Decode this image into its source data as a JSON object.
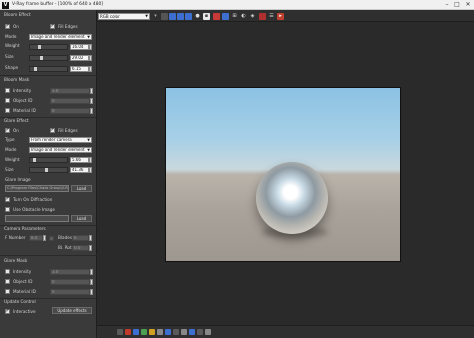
{
  "window": {
    "title": "V-Ray frame buffer - [100% of 640 x 480]",
    "app_icon": "V"
  },
  "bloom_effect": {
    "section": "Bloom Effect",
    "on_label": "On",
    "fill_edges_label": "Fill Edges",
    "mode_label": "Mode",
    "mode_value": "Image and render element",
    "weight_label": "Weight",
    "weight_value": "16.04",
    "size_label": "Size",
    "size_value": "29.02",
    "shape_label": "Shape",
    "shape_value": "6.15"
  },
  "bloom_mask": {
    "section": "Bloom Mask",
    "intensity_label": "Intensity",
    "intensity_value": "3.0",
    "object_id_label": "Object ID",
    "object_id_value": "0",
    "material_id_label": "Material ID",
    "material_id_value": "0"
  },
  "glare_effect": {
    "section": "Glare Effect",
    "on_label": "On",
    "fill_edges_label": "Fill Edges",
    "type_label": "Type",
    "type_value": "From render camera",
    "mode_label": "Mode",
    "mode_value": "Image and render element",
    "weight_label": "Weight",
    "weight_value": "5.66",
    "size_label": "Size",
    "size_value": "41.36",
    "glare_image_label": "Glare Image",
    "glare_image_path": "C:\\Program Files\\Chaos Group\\V-Ray",
    "load_label": "Load",
    "diffraction_label": "Turn On Diffraction",
    "obstacle_label": "Use Obstacle Image",
    "obstacle_load_label": "Load"
  },
  "camera_parameters": {
    "section": "Camera Parameters",
    "fnumber_label": "F Number",
    "fnumber_value": "8.0",
    "blades_label": "Blades",
    "blades_value": "6",
    "rotation_label": "Bl. Rot",
    "rotation_value": "0.0"
  },
  "glare_mask": {
    "section": "Glare Mask",
    "intensity_label": "Intensity",
    "intensity_value": "3.0",
    "object_id_label": "Object ID",
    "object_id_value": "0",
    "material_id_label": "Material ID",
    "material_id_value": "0"
  },
  "update_control": {
    "section": "Update Control",
    "interactive_label": "Interactive",
    "update_button": "Update effects"
  },
  "toolbar": {
    "channel_value": "RGB color",
    "icons": [
      "save-icon",
      "clear-icon",
      "red-channel-icon",
      "green-channel-icon",
      "blue-channel-icon",
      "mono-icon",
      "alpha-icon",
      "color-icon",
      "region-icon",
      "compare-icon",
      "track-icon",
      "lock-icon",
      "stop-icon",
      "history-icon",
      "render-icon"
    ]
  },
  "colors": {
    "panel": "#3a3a3a",
    "viewport": "#2a2a2a",
    "channel_blue": "#3c6fd0",
    "accent_red": "#c83a3a"
  }
}
